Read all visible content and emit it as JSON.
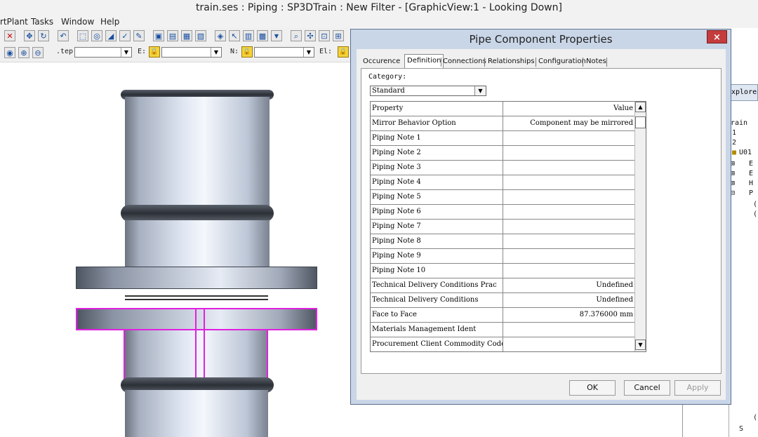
{
  "window": {
    "title": "train.ses : Piping : SP3DTrain : New Filter - [GraphicView:1 - Looking Down]"
  },
  "menu": [
    "rtPlant",
    "Tasks",
    "Window",
    "Help"
  ],
  "toolbar2": {
    "step_label": ".tep:",
    "e_label": "E:",
    "n_label": "N:",
    "el_label": "El:"
  },
  "explorer": {
    "header": "xplorer",
    "tree": [
      "rain",
      "1",
      "2",
      "U01",
      "E",
      "E",
      "H",
      "P",
      "(",
      "(",
      "(",
      "S"
    ]
  },
  "dialog": {
    "title": "Pipe Component Properties",
    "close": "×",
    "tabs": [
      "Occurence",
      "Definition",
      "Connections",
      "Relationships",
      "Configuration",
      "Notes"
    ],
    "active_tab": "Definition",
    "category_label": "Category:",
    "category_value": "Standard",
    "grid_header": {
      "property": "Property",
      "value": "Value"
    },
    "rows": [
      {
        "property": "Mirror Behavior Option",
        "value": "Component may be mirrored"
      },
      {
        "property": "Piping Note 1",
        "value": ""
      },
      {
        "property": "Piping Note 2",
        "value": ""
      },
      {
        "property": "Piping Note 3",
        "value": ""
      },
      {
        "property": "Piping Note 4",
        "value": ""
      },
      {
        "property": "Piping Note 5",
        "value": ""
      },
      {
        "property": "Piping Note 6",
        "value": ""
      },
      {
        "property": "Piping Note 7",
        "value": ""
      },
      {
        "property": "Piping Note 8",
        "value": ""
      },
      {
        "property": "Piping Note 9",
        "value": ""
      },
      {
        "property": "Piping Note 10",
        "value": ""
      },
      {
        "property": "Technical Delivery Conditions Prac",
        "value": "Undefined"
      },
      {
        "property": "Technical Delivery Conditions",
        "value": "Undefined"
      },
      {
        "property": "Face to Face",
        "value": "87.376000 mm"
      },
      {
        "property": "Materials Management Ident",
        "value": ""
      },
      {
        "property": "Procurement Client Commodity Code",
        "value": ""
      }
    ],
    "buttons": {
      "ok": "OK",
      "cancel": "Cancel",
      "apply": "Apply"
    }
  }
}
